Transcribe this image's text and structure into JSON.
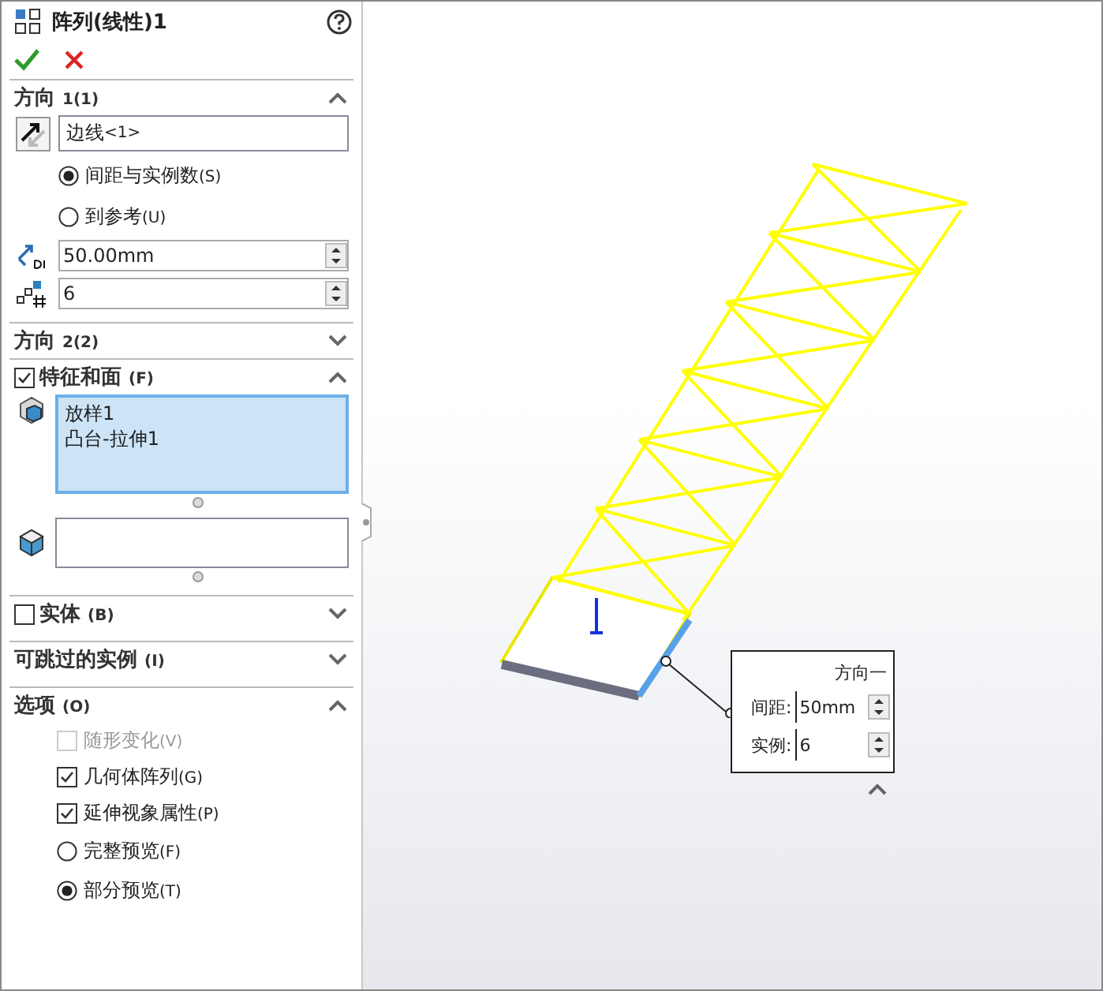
{
  "panel": {
    "title": "阵列(线性)1",
    "direction1": {
      "title": "方向",
      "hotkey": "1(1)",
      "expanded": true,
      "edge": "边线",
      "edge_tag": "<1>",
      "options": [
        {
          "label": "间距与实例数",
          "hotkey": "(S)",
          "selected": true
        },
        {
          "label": "到参考",
          "hotkey": "(U)",
          "selected": false
        }
      ],
      "spacing": "50.00mm",
      "count": "6"
    },
    "direction2": {
      "title": "方向",
      "hotkey": "2(2)",
      "expanded": false
    },
    "features": {
      "title": "特征和面",
      "hotkey": "(F)",
      "checked": true,
      "expanded": true,
      "items": [
        "放样1",
        "凸台-拉伸1"
      ]
    },
    "bodies": {
      "title": "实体",
      "hotkey": "(B)",
      "checked": false,
      "expanded": false
    },
    "skip": {
      "title": "可跳过的实例",
      "hotkey": "(I)",
      "expanded": false
    },
    "options": {
      "title": "选项",
      "hotkey": "(O)",
      "expanded": true,
      "items": [
        {
          "kind": "checkbox",
          "label": "随形变化",
          "hotkey": "(V)",
          "checked": false,
          "disabled": true
        },
        {
          "kind": "checkbox",
          "label": "几何体阵列",
          "hotkey": "(G)",
          "checked": true,
          "disabled": false
        },
        {
          "kind": "checkbox",
          "label": "延伸视象属性",
          "hotkey": "(P)",
          "checked": true,
          "disabled": false
        },
        {
          "kind": "radio",
          "label": "完整预览",
          "hotkey": "(F)",
          "selected": false
        },
        {
          "kind": "radio",
          "label": "部分预览",
          "hotkey": "(T)",
          "selected": true
        }
      ]
    }
  },
  "callout": {
    "title": "方向一",
    "spacing_label": "间距:",
    "spacing": "50mm",
    "count_label": "实例:",
    "count": "6"
  }
}
